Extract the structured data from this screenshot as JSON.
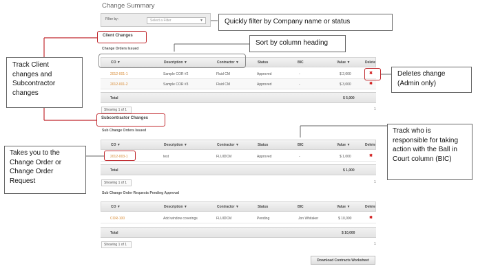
{
  "page": {
    "title": "Change Summary"
  },
  "filter": {
    "label": "Filter by:",
    "placeholder": "Select a Filter"
  },
  "client": {
    "title": "Client Changes",
    "subtitle": "Change Orders Issued",
    "columns": [
      "CO",
      "Description",
      "Contractor",
      "Status",
      "BIC",
      "Value",
      "Delete"
    ],
    "rows": [
      {
        "co": "2012-001-1",
        "description": "Sample COR #2",
        "contractor": "Fluid CM",
        "status": "Approved",
        "bic": "-",
        "value": "$ 2,000"
      },
      {
        "co": "2012-001-2",
        "description": "Sample COR #3",
        "contractor": "Fluid CM",
        "status": "Approved",
        "bic": "-",
        "value": "$ 3,000"
      }
    ],
    "total_label": "Total",
    "total_value": "$ 5,000",
    "showing": "Showing 1 of 1"
  },
  "subcontractor": {
    "title": "Subcontractor Changes",
    "subtitle": "Sub Change Orders Issued",
    "columns": [
      "CO",
      "Description",
      "Contractor",
      "Status",
      "BIC",
      "Value",
      "Delete"
    ],
    "rows": [
      {
        "co": "2012-003-1",
        "description": "test",
        "contractor": "FLUIDCM",
        "status": "Approved",
        "bic": "-",
        "value": "$ 1,000"
      }
    ],
    "total_label": "Total",
    "total_value": "$ 1,000",
    "showing": "Showing 1 of 1"
  },
  "pending": {
    "subtitle": "Sub Change Order Requests Pending Approval",
    "columns": [
      "CO",
      "Description",
      "Contractor",
      "Status",
      "BIC",
      "Value",
      "Delete"
    ],
    "rows": [
      {
        "co": "COR-100",
        "description": "Add window coverings",
        "contractor": "FLUIDCM",
        "status": "Pending",
        "bic": "Jon Whitaker",
        "value": "$ 10,000"
      }
    ],
    "total_label": "Total",
    "total_value": "$ 10,000",
    "showing": "Showing 1 of 1"
  },
  "pager_page": "1",
  "delete_glyph": "✖",
  "sort_glyph": "▼",
  "download_button": "Download Contracts Worksheet",
  "callouts": {
    "filter": "Quickly filter by Company name or status",
    "sort": "Sort by column heading",
    "track_client": "Track Client changes and Subcontractor changes",
    "deletes": "Deletes change (Admin only)",
    "bic": "Track who is responsible for taking action with the Ball in Court column (BIC)",
    "takes_you": "Takes you to the Change Order or Change Order Request"
  },
  "colors": {
    "link": "#d7872d",
    "delete": "#d21f1f",
    "highlight_box": "#c0282d"
  }
}
